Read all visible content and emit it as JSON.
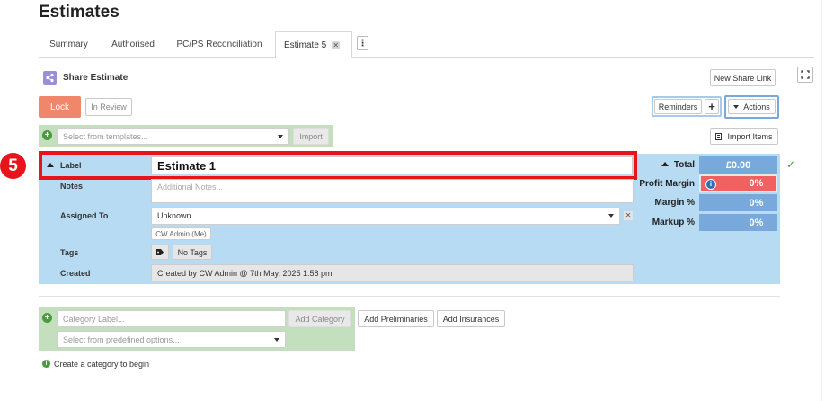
{
  "page": {
    "title": "Estimates"
  },
  "tabs": [
    {
      "label": "Summary"
    },
    {
      "label": "Authorised"
    },
    {
      "label": "PC/PS Reconciliation"
    },
    {
      "label": "Estimate 5"
    }
  ],
  "share": {
    "label": "Share Estimate",
    "new_link_label": "New Share Link"
  },
  "status": {
    "lock_label": "Lock",
    "review_label": "In Review"
  },
  "toolbar": {
    "reminders_label": "Reminders",
    "plus_label": "+",
    "actions_label": "Actions",
    "import_items_label": "Import Items"
  },
  "templates": {
    "placeholder": "Select from templates...",
    "import_label": "Import"
  },
  "step_badge": "5",
  "form": {
    "label_field": "Label",
    "label_value": "Estimate 1",
    "notes_field": "Notes",
    "notes_placeholder": "Additional Notes...",
    "assigned_field": "Assigned To",
    "assigned_value": "Unknown",
    "assigned_chip": "CW Admin (Me)",
    "tags_field": "Tags",
    "tags_value": "No Tags",
    "created_field": "Created",
    "created_value": "Created by CW Admin @ 7th May, 2025 1:58 pm"
  },
  "totals": {
    "total_label": "Total",
    "total_value": "£0.00",
    "profit_label": "Profit Margin",
    "profit_value": "0%",
    "margin_label": "Margin %",
    "margin_value": "0%",
    "markup_label": "Markup %",
    "markup_value": "0%"
  },
  "category": {
    "label_placeholder": "Category Label...",
    "add_label": "Add Category",
    "predefined_placeholder": "Select from predefined options...",
    "preliminaries_label": "Add Preliminaries",
    "insurances_label": "Add Insurances",
    "hint": "Create a category to begin"
  },
  "colors": {
    "accent_blue": "#79a9db",
    "panel_blue": "#b7dbf2",
    "lock": "#f0866a",
    "profit": "#f06262",
    "green_panel": "#c3dfbd",
    "highlight": "#e8141c"
  },
  "icons": [
    "share-icon",
    "expand-icon",
    "kebab-icon",
    "close-icon",
    "plus-icon",
    "caret-up-icon",
    "caret-down-icon",
    "tag-icon",
    "info-icon",
    "import-icon",
    "check-icon",
    "clear-icon"
  ]
}
